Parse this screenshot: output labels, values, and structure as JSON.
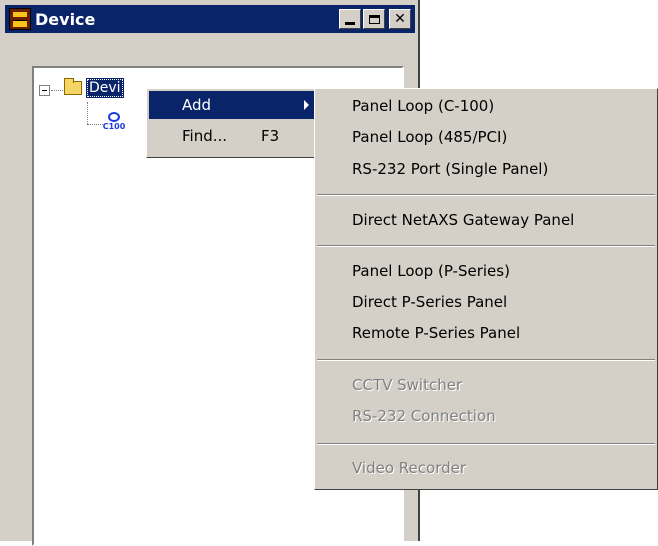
{
  "window": {
    "title": "Device"
  },
  "tree": {
    "root_label": "Devi",
    "child_label": "C100"
  },
  "context_menu": {
    "items": [
      {
        "label": "Add",
        "shortcut": ""
      },
      {
        "label": "Find...",
        "shortcut": "F3"
      }
    ]
  },
  "submenu": {
    "items": [
      {
        "label": "Panel Loop (C-100)",
        "enabled": true
      },
      {
        "label": "Panel Loop (485/PCI)",
        "enabled": true
      },
      {
        "label": "RS-232 Port (Single Panel)",
        "enabled": true
      },
      {
        "label": "Direct NetAXS Gateway Panel",
        "enabled": true
      },
      {
        "label": "Panel Loop (P-Series)",
        "enabled": true
      },
      {
        "label": "Direct P-Series Panel",
        "enabled": true
      },
      {
        "label": "Remote P-Series Panel",
        "enabled": true
      },
      {
        "label": "CCTV Switcher",
        "enabled": false
      },
      {
        "label": "RS-232 Connection",
        "enabled": false
      },
      {
        "label": "Video Recorder",
        "enabled": false
      }
    ]
  }
}
